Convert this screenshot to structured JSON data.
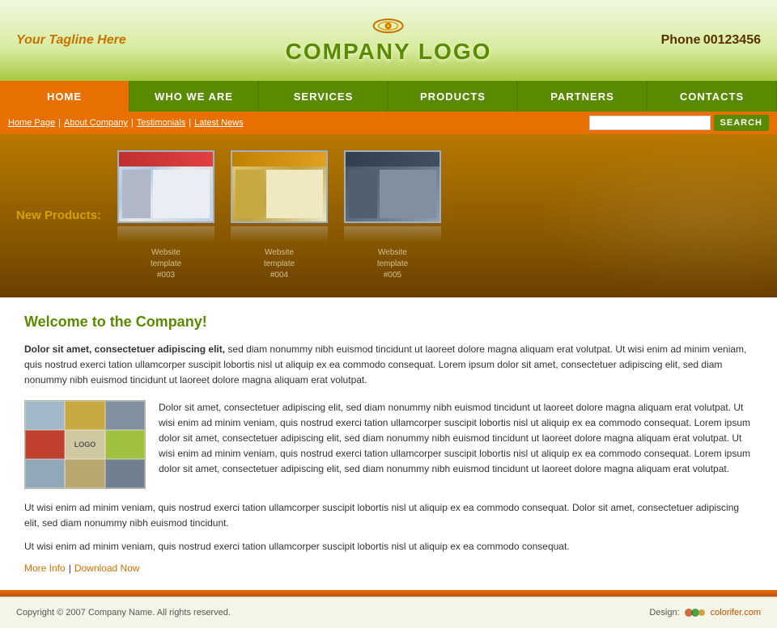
{
  "header": {
    "tagline": "Your Tagline Here",
    "logo_text": "COMPANY LOGO",
    "phone_label": "Phone",
    "phone_number": "00123456"
  },
  "nav": {
    "items": [
      {
        "label": "HOME",
        "active": true
      },
      {
        "label": "WHO WE ARE",
        "active": false
      },
      {
        "label": "SERVICES",
        "active": false
      },
      {
        "label": "PRODUCTS",
        "active": false
      },
      {
        "label": "PARTNERS",
        "active": false
      },
      {
        "label": "CONTACTS",
        "active": false
      }
    ]
  },
  "breadcrumb": {
    "links": [
      {
        "label": "Home Page"
      },
      {
        "label": "About Company"
      },
      {
        "label": "Testimonials"
      },
      {
        "label": "Latest News"
      }
    ],
    "search_placeholder": "",
    "search_button": "SEARCH"
  },
  "banner": {
    "new_products_label": "New Products:",
    "templates": [
      {
        "label": "Website\ntemplate\n#003",
        "style": "003"
      },
      {
        "label": "Website\ntemplate\n#004",
        "style": "004"
      },
      {
        "label": "Website\ntemplate\n#005",
        "style": "005"
      }
    ]
  },
  "main": {
    "welcome_title": "Welcome to the Company!",
    "intro_bold": "Dolor sit amet, consectetuer adipiscing elit,",
    "intro_text": " sed diam nonummy nibh euismod tincidunt ut laoreet dolore magna aliquam erat volutpat. Ut wisi enim ad minim veniam, quis nostrud exerci tation ullamcorper suscipit lobortis nisl ut aliquip ex ea commodo consequat. Lorem ipsum dolor sit amet, consectetuer adipiscing elit, sed diam nonummy nibh euismod tincidunt ut laoreet dolore magna aliquam erat volutpat.",
    "content_para": "Dolor sit amet, consectetuer adipiscing elit, sed diam nonummy nibh euismod tincidunt ut laoreet dolore magna aliquam erat volutpat. Ut wisi enim ad minim veniam, quis nostrud exerci tation ullamcorper suscipit lobortis nisl ut aliquip ex ea commodo consequat. Lorem ipsum dolor sit amet, consectetuer adipiscing elit, sed diam nonummy nibh euismod tincidunt ut laoreet dolore magna aliquam erat volutpat. Ut wisi enim ad minim veniam, quis nostrud exerci tation ullamcorper suscipit lobortis nisl ut aliquip ex ea commodo consequat. Lorem ipsum dolor sit amet, consectetuer adipiscing elit, sed diam nonummy nibh euismod tincidunt ut laoreet dolore magna aliquam erat volutpat.",
    "content_para2": "Ut wisi enim ad minim veniam, quis nostrud exerci tation ullamcorper suscipit lobortis nisl ut aliquip ex ea commodo consequat. Dolor sit amet, consectetuer adipiscing elit, sed diam nonummy nibh euismod tincidunt.",
    "bottom_text": "Ut wisi enim ad minim veniam, quis nostrud exerci tation ullamcorper suscipit lobortis nisl ut aliquip ex ea commodo consequat.",
    "more_info_link": "More Info",
    "download_link": "Download Now",
    "logo_cell": "LOGO"
  },
  "footer": {
    "copyright": "Copyright © 2007 Company Name. All rights reserved.",
    "design_label": "Design:",
    "design_link": "colorifer.com"
  }
}
